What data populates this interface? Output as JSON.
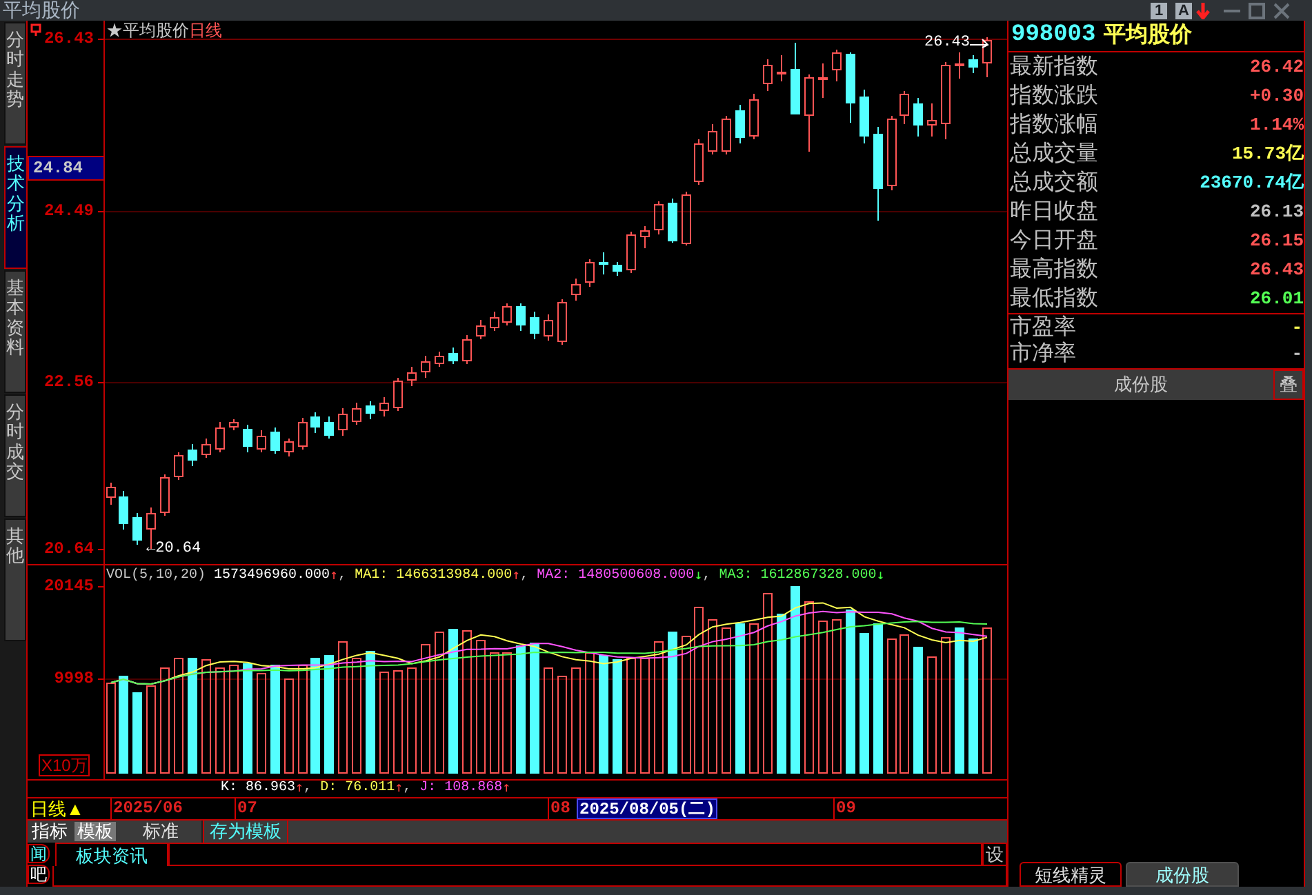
{
  "window": {
    "title": "平均股价",
    "buttons": [
      "1",
      "A"
    ]
  },
  "side_tabs": [
    {
      "label": "分时走势",
      "selected": false
    },
    {
      "label": "技术分析",
      "selected": true
    },
    {
      "label": "基本资料",
      "selected": false
    },
    {
      "label": "分时成交",
      "selected": false
    },
    {
      "label": "其他",
      "selected": false
    }
  ],
  "price_chart": {
    "title": "★平均股价",
    "period": "日线",
    "axis_labels": [
      "26.43",
      "24.49",
      "22.56",
      "20.64"
    ],
    "cursor_value": "24.84",
    "high_label": "26.43",
    "low_label": "←20.64"
  },
  "volume_chart": {
    "indicator": "VOL(5,10,20)",
    "readings": [
      {
        "text": "1573496960.000",
        "color": "#ffffff",
        "arrow": "↑",
        "rising": true
      },
      {
        "prefix": ",",
        "text": "MA1: 1466313984.000",
        "color": "#ffff54",
        "arrow": "↑",
        "rising": true
      },
      {
        "prefix": ",",
        "text": "MA2: 1480500608.000",
        "color": "#ff54ff",
        "arrow": "↓",
        "rising": false
      },
      {
        "prefix": ",",
        "text": "MA3: 1612867328.000",
        "color": "#54ff54",
        "arrow": "↓",
        "rising": false
      }
    ],
    "axis_labels": [
      "20145",
      "9998"
    ],
    "unit": "X10万"
  },
  "kdj": {
    "readings": [
      {
        "text": "K: 86.963",
        "color": "#ffffff",
        "arrow": "↑",
        "rising": true
      },
      {
        "prefix": ",",
        "text": "D: 76.011",
        "color": "#ffff54",
        "arrow": "↑",
        "rising": true
      },
      {
        "prefix": ",",
        "text": "J: 108.868",
        "color": "#ff54ff",
        "arrow": "↑",
        "rising": true
      }
    ]
  },
  "date_axis": {
    "period": "日线▲",
    "labels": [
      "2025/06",
      "07",
      "08",
      "09"
    ],
    "cursor_date": "2025/08/05(二)"
  },
  "template_tabs": [
    {
      "label": "指标",
      "kind": "toggle",
      "selected": false
    },
    {
      "label": "模板",
      "kind": "toggle",
      "selected": true
    },
    {
      "label": "标准",
      "kind": "template",
      "selected": false
    },
    {
      "label": "存为模板",
      "kind": "action",
      "selected": false
    }
  ],
  "info_panel": {
    "side_tabs": [
      {
        "label": "闻",
        "selected": true
      },
      {
        "label": "吧",
        "selected": false
      }
    ],
    "tabs": [
      {
        "label": "板块资讯",
        "selected": true
      }
    ],
    "settings": "设"
  },
  "quote_panel": {
    "code": "998003",
    "name": "平均股价",
    "rows": [
      {
        "label": "最新指数",
        "value": "26.42",
        "color": "#ff5454"
      },
      {
        "label": "指数涨跌",
        "value": "+0.30",
        "color": "#ff5454"
      },
      {
        "label": "指数涨幅",
        "value": "1.14%",
        "color": "#ff5454"
      },
      {
        "label": "总成交量",
        "value": "15.73亿",
        "color": "#ffff54"
      },
      {
        "label": "总成交额",
        "value": "23670.74亿",
        "color": "#54ffff"
      },
      {
        "label": "昨日收盘",
        "value": "26.13",
        "color": "#c0c0c0"
      },
      {
        "label": "今日开盘",
        "value": "26.15",
        "color": "#ff5454"
      },
      {
        "label": "最高指数",
        "value": "26.43",
        "color": "#ff5454"
      },
      {
        "label": "最低指数",
        "value": "26.01",
        "color": "#54ff54"
      }
    ],
    "ratios": [
      {
        "label": "市盈率",
        "value": "-",
        "color": "#ffff54"
      },
      {
        "label": "市净率",
        "value": "-",
        "color": "#c0c0c0"
      }
    ],
    "section_title": "成份股",
    "overlay_button": "叠",
    "tabs": [
      {
        "label": "短线精灵",
        "selected": false
      },
      {
        "label": "成份股",
        "selected": true
      }
    ]
  }
}
